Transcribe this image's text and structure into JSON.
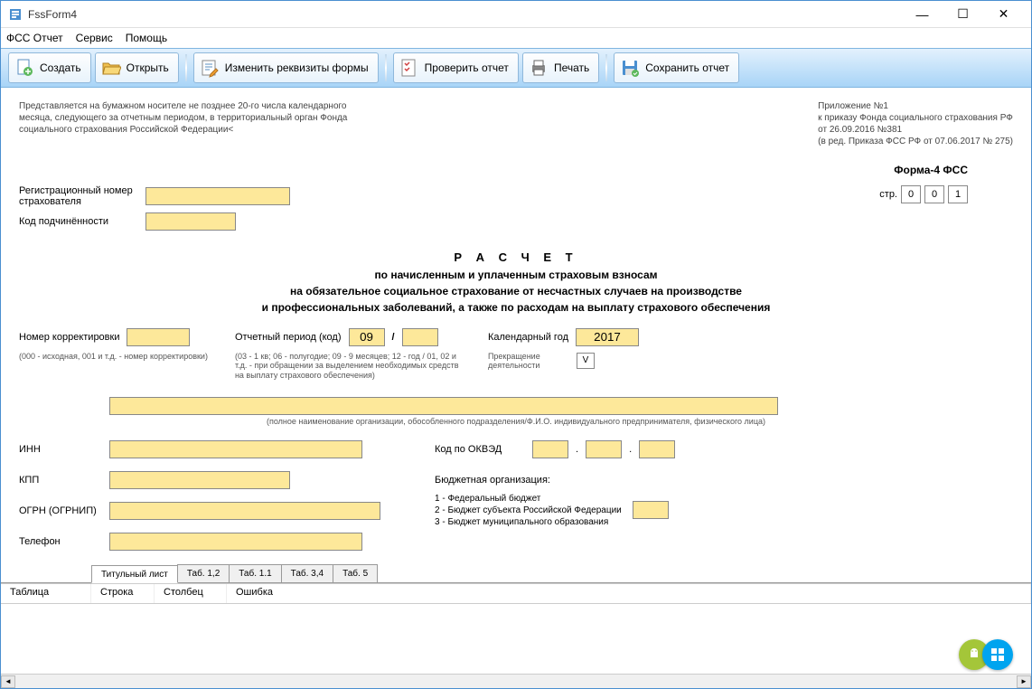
{
  "titlebar": {
    "title": "FssForm4"
  },
  "menu": {
    "report": "ФСС Отчет",
    "service": "Сервис",
    "help": "Помощь"
  },
  "toolbar": {
    "create": "Создать",
    "open": "Открыть",
    "edit_props": "Изменить реквизиты формы",
    "check": "Проверить отчет",
    "print": "Печать",
    "save": "Сохранить отчет"
  },
  "notes": {
    "left": "Представляется на бумажном носителе не позднее 20-го числа календарного месяца, следующего за отчетным периодом, в территориальный орган Фонда социального страхования Российской Федерации<",
    "right1": "Приложение №1",
    "right2": "к приказу Фонда социального страхования РФ",
    "right3": "от 26.09.2016 №381",
    "right4": "(в ред. Приказа ФСС РФ от 07.06.2017 № 275)"
  },
  "form_badge": "Форма-4 ФСС",
  "labels": {
    "reg_num": "Регистрационный номер страхователя",
    "sub_code": "Код подчинённости",
    "page": "стр.",
    "corr_num": "Номер корректировки",
    "period": "Отчетный период (код)",
    "year": "Календарный год",
    "stop": "Прекращение деятельности",
    "inn": "ИНН",
    "kpp": "КПП",
    "ogrn": "ОГРН (ОГРНИП)",
    "phone": "Телефон",
    "okved": "Код по ОКВЭД",
    "budget": "Бюджетная организация:"
  },
  "page_cells": [
    "0",
    "0",
    "1"
  ],
  "title_block": {
    "h": "Р А С Ч Е Т",
    "l1": "по начисленным и уплаченным страховым взносам",
    "l2": "на обязательное социальное страхование от несчастных случаев на производстве",
    "l3": "и профессиональных заболеваний, а также по расходам на выплату страхового обеспечения"
  },
  "hints": {
    "corr": "(000 - исходная, 001 и т.д. - номер корректировки)",
    "period": "(03 - 1 кв; 06 - полугодие; 09 - 9 месяцев; 12 - год / 01, 02 и т.д. - при обращении за выделением необходимых средств на выплату страхового обеспечения)",
    "fullname": "(полное наименование организации, обособленного подразделения/Ф.И.О. индивидуального предпринимателя, физического лица)"
  },
  "values": {
    "period_a": "09",
    "period_b": "",
    "year": "2017",
    "stop_flag": "V"
  },
  "budget_items": [
    "1 - Федеральный бюджет",
    "2 - Бюджет субъекта Российской Федерации",
    "3 - Бюджет муниципального образования"
  ],
  "tabs": [
    "Титульный лист",
    "Таб. 1,2",
    "Таб. 1.1",
    "Таб. 3,4",
    "Таб. 5"
  ],
  "errors_header": [
    "Таблица",
    "Строка",
    "Столбец",
    "Ошибка"
  ]
}
